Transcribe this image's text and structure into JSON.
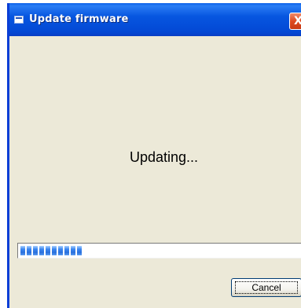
{
  "window": {
    "title": "Update firmware",
    "close_glyph": "X"
  },
  "status": {
    "message": "Updating..."
  },
  "progress": {
    "percent": 24,
    "chunk_count": 10
  },
  "buttons": {
    "cancel_label": "Cancel"
  },
  "icons": {
    "title_icon": "app-window-icon",
    "close_icon": "close-icon"
  },
  "colors": {
    "titlebar": "#0756e0",
    "close_button": "#dd4a21",
    "window_background": "#ece9d8",
    "progress_chunk": "#2a70dc"
  }
}
